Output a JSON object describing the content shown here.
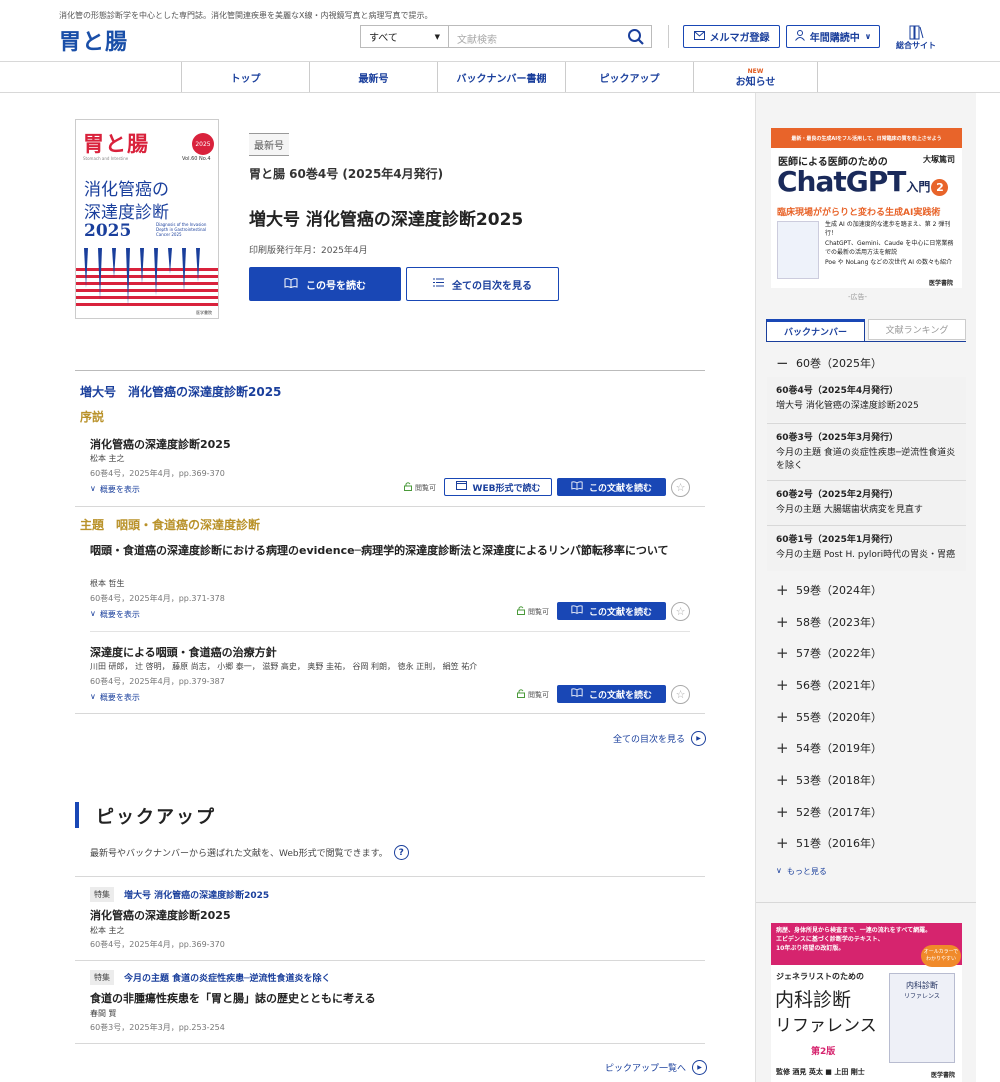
{
  "header": {
    "tagline": "消化管の形態診断学を中心とした専門誌。消化管関連疾患を美麗なX線・内視鏡写真と病理写真で提示。",
    "logo": "胃と腸",
    "search_scope": "すべて",
    "search_placeholder": "文献検索",
    "newsletter_label": "メルマガ登録",
    "subscribe_label": "年間購読中",
    "portal_label": "総合サイト"
  },
  "nav": {
    "items": [
      "トップ",
      "最新号",
      "バックナンバー書棚",
      "ピックアップ",
      "お知らせ"
    ],
    "new_badge": "NEW"
  },
  "issue": {
    "badge": "最新号",
    "issue_line": "胃と腸 60巻4号 (2025年4月発行)",
    "title": "増大号 消化管癌の深達度診断2025",
    "print_date": "印刷版発行年月：2025年4月",
    "read_button": "この号を読む",
    "toc_button": "全ての目次を見る",
    "cover": {
      "logo": "胃と腸",
      "logo_en": "Stomach and Intestine",
      "year": "2025",
      "vol": "Vol.60 No.4",
      "title_line1": "消化管癌の",
      "title_line2": "深達度診断",
      "title_year": "2025",
      "subtitle_en": "Diagnosis of the Invasion Depth in Gastrointestinal Cancer 2025",
      "publisher": "医学書院"
    }
  },
  "toc": {
    "section_title": "増大号　消化管癌の深達度診断2025",
    "groups": [
      {
        "heading": "序説",
        "articles": [
          {
            "title": "消化管癌の深達度診断2025",
            "authors": "松本 主之",
            "meta": "60巻4号，2025年4月，pp.369-370",
            "abstract_toggle": "概要を表示",
            "access": "閲覧可",
            "web_button": "WEB形式で読む",
            "read_button": "この文献を読む"
          }
        ]
      },
      {
        "heading": "主題　咽頭・食道癌の深達度診断",
        "articles": [
          {
            "title": "咽頭・食道癌の深達度診断における病理のevidence─病理学的深達度診断法と深達度によるリンパ節転移率について",
            "authors": "根本 哲生",
            "meta": "60巻4号，2025年4月，pp.371-378",
            "abstract_toggle": "概要を表示",
            "access": "閲覧可",
            "read_button": "この文献を読む"
          },
          {
            "title": "深達度による咽頭・食道癌の治療方針",
            "authors": "川田 研郎， 辻 啓明， 藤原 尚志， 小郷 泰一， 滋野 高史， 奥野 圭祐， 谷岡 利朗， 徳永 正則， 絹笠 祐介",
            "meta": "60巻4号，2025年4月，pp.379-387",
            "abstract_toggle": "概要を表示",
            "access": "閲覧可",
            "read_button": "この文献を読む"
          }
        ]
      }
    ],
    "all_link": "全ての目次を見る"
  },
  "pickup": {
    "title": "ピックアップ",
    "description": "最新号やバックナンバーから選ばれた文献を、Web形式で閲覧できます。",
    "items": [
      {
        "tag": "特集",
        "feature": "増大号 消化管癌の深達度診断2025",
        "title": "消化管癌の深達度診断2025",
        "authors": "松本 主之",
        "meta": "60巻4号，2025年4月，pp.369-370"
      },
      {
        "tag": "特集",
        "feature": "今月の主題 食道の炎症性疾患─逆流性食道炎を除く",
        "title": "食道の非腫瘍性疾患を「胃と腸」誌の歴史とともに考える",
        "authors": "春間 賢",
        "meta": "60巻3号，2025年3月，pp.253-254"
      }
    ],
    "all_link": "ピックアップ一覧へ"
  },
  "sidebar": {
    "ad1": {
      "banner": "最新・最良の生成AIをフル活用して、日常臨床の質を向上させよう",
      "lead": "医師による医師のための",
      "author": "大塚篤司",
      "title": "ChatGPT",
      "title_suffix": "入門",
      "number": "2",
      "subtitle": "臨床現場ががらりと変わる生成AI実践術",
      "bullets": [
        "生成 AI の加速度的な進歩を踏まえ、第 2 弾刊行！",
        "ChatGPT、Gemini、Caude を中心に日常業務での最新の活用方法を解説",
        "Poe や NoLang などの次世代 AI の数々も紹介"
      ],
      "publisher": "医学書院",
      "ad_label": "-広告-"
    },
    "tabs": [
      "バックナンバー",
      "文献ランキング"
    ],
    "open_volume": "60巻（2025年）",
    "issues": [
      {
        "label": "60巻4号（2025年4月発行）",
        "desc": "増大号 消化管癌の深達度診断2025"
      },
      {
        "label": "60巻3号（2025年3月発行）",
        "desc": "今月の主題 食道の炎症性疾患─逆流性食道炎を除く"
      },
      {
        "label": "60巻2号（2025年2月発行）",
        "desc": "今月の主題 大腸鋸歯状病変を見直す"
      },
      {
        "label": "60巻1号（2025年1月発行）",
        "desc": "今月の主題 Post H. pylori時代の胃炎・胃癌"
      }
    ],
    "volumes": [
      "59巻（2024年）",
      "58巻（2023年）",
      "57巻（2022年）",
      "56巻（2021年）",
      "55巻（2020年）",
      "54巻（2019年）",
      "53巻（2018年）",
      "52巻（2017年）",
      "51巻（2016年）"
    ],
    "more": "もっと見る",
    "ad2": {
      "banner_line1": "病歴、身体所見から検査まで、一連の流れをすべて網羅。",
      "banner_line2": "エビデンスに基づく診断学のテキスト、",
      "banner_line3": "10年ぶり待望の改訂版。",
      "badge": "オールカラーでわかりやすい",
      "lead": "ジェネラリストのための",
      "title_line1": "内科診断",
      "title_line2": "リファレンス",
      "edition": "第2版",
      "editors": "監修 酒見 英太 ■ 上田 剛士",
      "book_title": "内科診断",
      "book_sub": "リファレンス",
      "publisher": "医学書院"
    }
  },
  "colors": {
    "primary": "#1947b5",
    "accent_gold": "#b9922a",
    "nav_text": "#1a3f9c",
    "new_badge": "#e05a1f",
    "cover_red": "#d9223c"
  }
}
